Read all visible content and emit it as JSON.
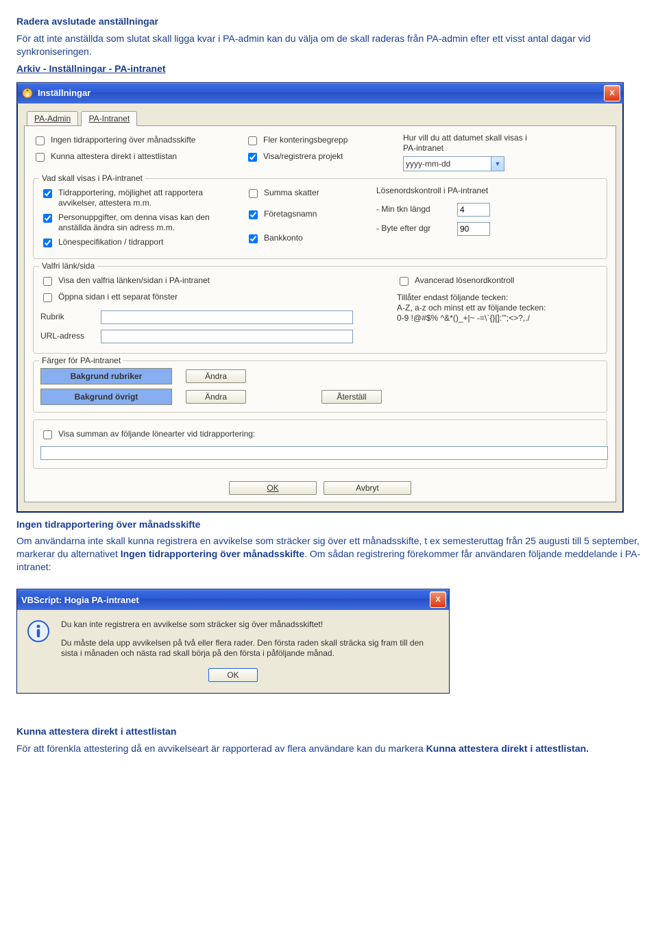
{
  "intro": {
    "h1": "Radera avslutade anställningar",
    "p1": "För att inte anställda som slutat skall ligga kvar i PA-admin kan du välja om de skall raderas från PA-admin efter ett visst antal dagar vid synkroniseringen.",
    "linkline": "Arkiv - Inställningar - PA-intranet"
  },
  "dialog": {
    "title": "Inställningar",
    "close_label": "X",
    "tabs": [
      {
        "label": "PA-Admin"
      },
      {
        "label": "PA-Intranet",
        "active": true
      }
    ],
    "topLeft": [
      {
        "label": "Ingen tidrapportering över månadsskifte",
        "checked": false
      },
      {
        "label": "Kunna attestera direkt i attestlistan",
        "checked": false
      }
    ],
    "topMid": [
      {
        "label": "Fler konteringsbegrepp",
        "checked": false
      },
      {
        "label": "Visa/registrera projekt",
        "checked": true
      }
    ],
    "topRight": {
      "caption": "Hur vill du att datumet skall visas i PA-intranet",
      "value": "yyyy-mm-dd"
    },
    "visas": {
      "legend": "Vad skall visas i PA-intranet",
      "left": [
        {
          "label": "Tidrapportering, möjlighet att rapportera avvikelser, attestera m.m.",
          "checked": true
        },
        {
          "label": "Personuppgifter, om denna visas kan den anställda ändra sin adress m.m.",
          "checked": true
        },
        {
          "label": "Lönespecifikation / tidrapport",
          "checked": true
        }
      ],
      "mid": [
        {
          "label": "Summa skatter",
          "checked": false
        },
        {
          "label": "Företagsnamn",
          "checked": true
        },
        {
          "label": "Bankkonto",
          "checked": true
        }
      ],
      "right": {
        "caption": "Lösenordskontroll i PA-intranet",
        "minlen_label": "- Min tkn längd",
        "minlen_value": "4",
        "byte_label": "- Byte efter dgr",
        "byte_value": "90"
      }
    },
    "valfri": {
      "legend": "Valfri länk/sida",
      "c1": {
        "label": "Visa den valfria länken/sidan i PA-intranet",
        "checked": false
      },
      "c2": {
        "label": "Öppna sidan i ett separat fönster",
        "checked": false
      },
      "rubrik_label": "Rubrik",
      "rubrik_value": "",
      "url_label": "URL-adress",
      "url_value": "",
      "adv": {
        "label": "Avancerad lösenordkontroll",
        "checked": false
      },
      "adv_text1": "Tillåter endast följande tecken:",
      "adv_text2": "A-Z, a-z och minst ett av följande tecken: 0-9 !@#$% ^&*()_+|~ -=\\`{}[]:'\";<>?,./"
    },
    "farger": {
      "legend": "Färger för PA-intranet",
      "r1_label": "Bakgrund rubriker",
      "r2_label": "Bakgrund övrigt",
      "andra": "Ändra",
      "aterstall": "Återställ"
    },
    "bottom": {
      "sum_label": "Visa summan av följande lönearter vid tidrapportering:",
      "sum_value": ""
    },
    "footer": {
      "ok": "OK",
      "cancel": "Avbryt"
    }
  },
  "after1": {
    "h": "Ingen tidrapportering över månadsskifte",
    "p": "Om användarna inte skall kunna registrera en avvikelse som sträcker sig över ett månadsskifte, t ex semesteruttag från 25 augusti till 5 september, markerar du alternativet ",
    "b": "Ingen tidrapportering över månadsskifte",
    "p2": ". Om sådan registrering förekommer får användaren följande meddelande i PA-intranet:"
  },
  "msgbox": {
    "title": "VBScript: Hogia PA-intranet",
    "line1": "Du kan inte registrera en avvikelse som sträcker sig över månadsskiftet!",
    "line2": "Du måste dela upp avvikelsen på två eller flera rader. Den första raden skall sträcka sig fram till den sista i månaden och nästa rad skall börja på den första i påföljande månad.",
    "ok": "OK"
  },
  "after2": {
    "h": "Kunna attestera direkt i attestlistan",
    "p": "För att förenkla attestering då en avvikelseart är rapporterad av flera användare kan du markera ",
    "b": "Kunna attestera direkt i attestlistan."
  }
}
